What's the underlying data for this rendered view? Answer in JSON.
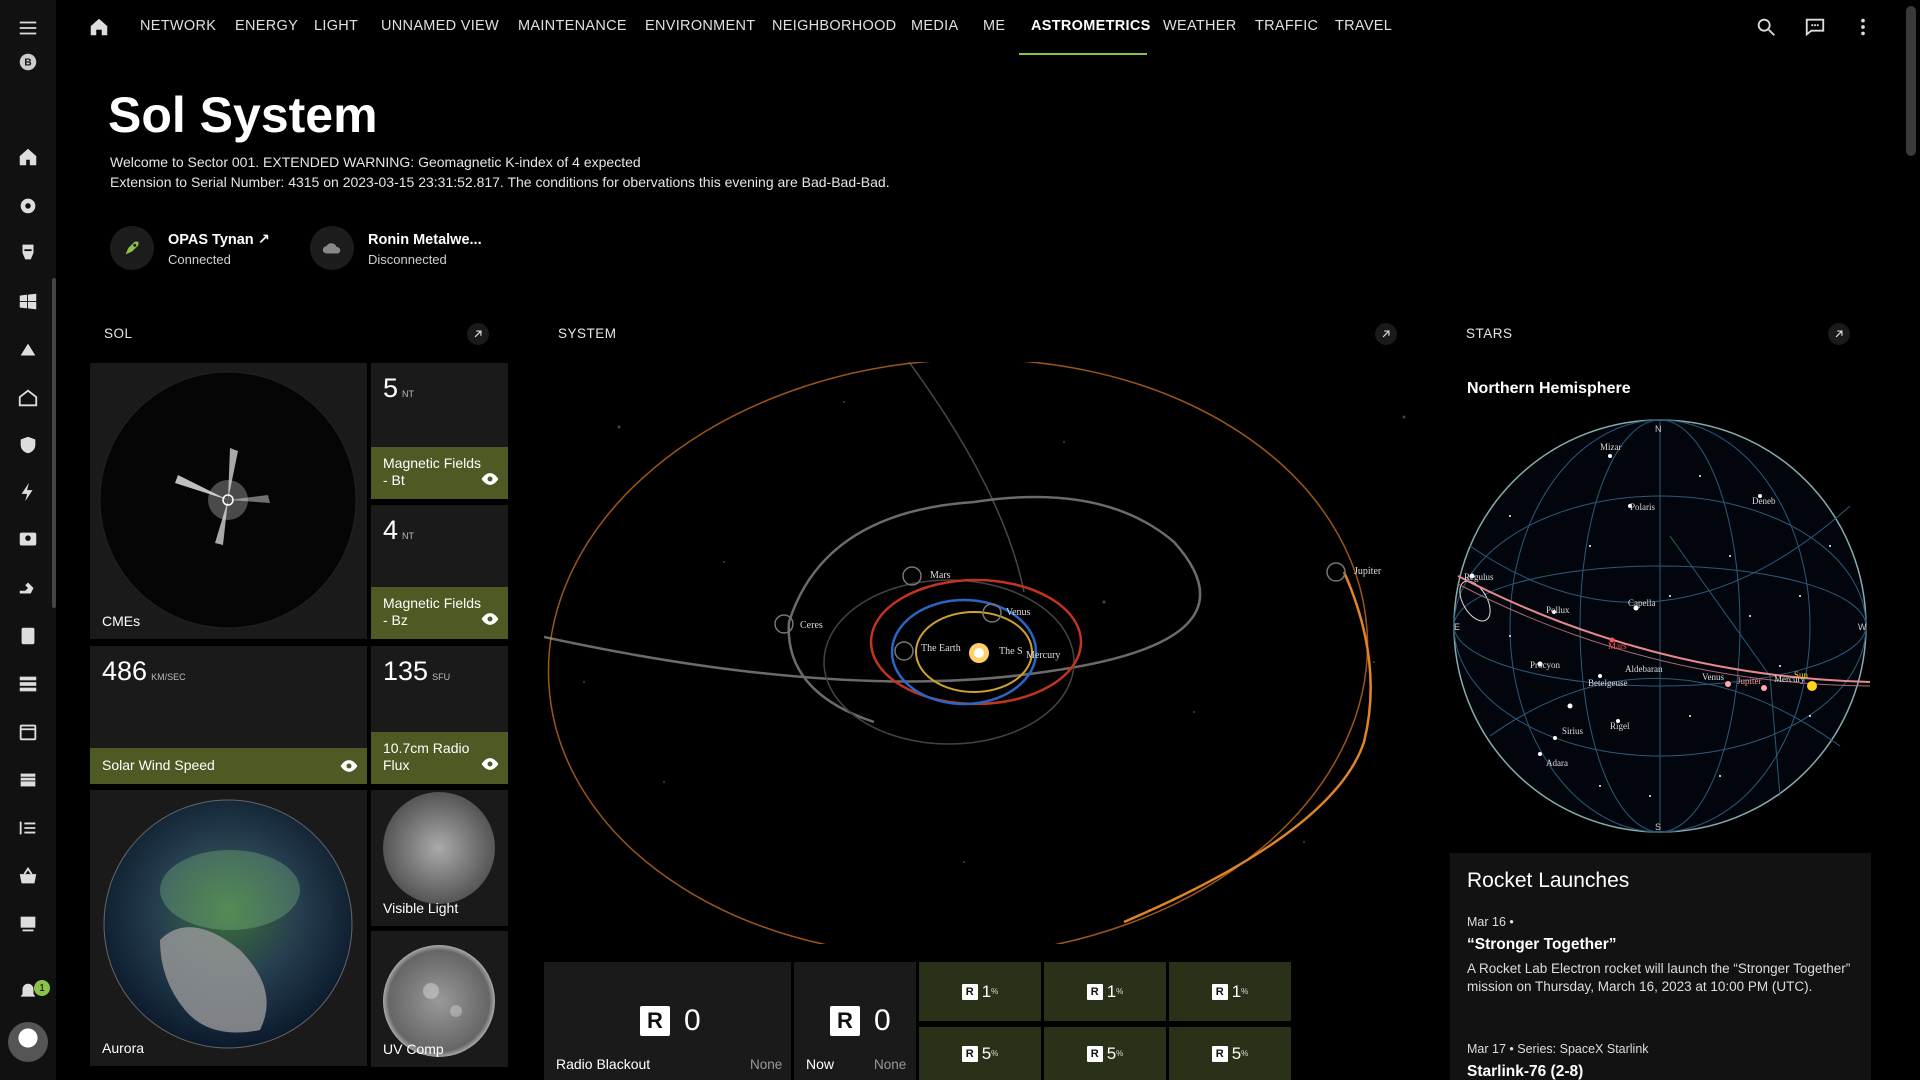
{
  "nav": {
    "tabs": [
      "NETWORK",
      "ENERGY",
      "LIGHT",
      "UNNAMED VIEW",
      "MAINTENANCE",
      "ENVIRONMENT",
      "NEIGHBORHOOD",
      "MEDIA",
      "ME",
      "ASTROMETRICS",
      "WEATHER",
      "TRAFFIC",
      "TRAVEL"
    ],
    "active_tab": "ASTROMETRICS",
    "accent_color": "#8bc34a"
  },
  "sidebar": {
    "icons": [
      "menu-icon",
      "brand-icon",
      "home-icon",
      "rebel-icon",
      "mandalorian-icon",
      "windows-icon",
      "alert-bell-icon",
      "house-icon",
      "shield-icon",
      "lightning-icon",
      "contact-icon",
      "vacuum-icon",
      "device-icon",
      "server-icon",
      "calendar-icon",
      "battery-icon",
      "list-icon",
      "basket-icon",
      "nas-icon",
      "notifications-icon",
      "avatar"
    ],
    "notification_count": "1"
  },
  "header": {
    "title": "Sol System",
    "line1": "Welcome to Sector 001. EXTENDED WARNING: Geomagnetic K-index of 4 expected",
    "line2": "Extension to Serial Number: 4315 on 2023-03-15 23:31:52.817. The conditions for obervations this evening are Bad-Bad-Bad."
  },
  "devices": [
    {
      "name": "OPAS Tynan ↗",
      "status": "Connected"
    },
    {
      "name": "Ronin Metalwe...",
      "status": "Disconnected"
    }
  ],
  "sections": {
    "sol": "SOL",
    "system": "SYSTEM",
    "stars": "STARS"
  },
  "sol": {
    "cmes_label": "CMEs",
    "bt": {
      "value": "5",
      "unit": "NT",
      "label": "Magnetic Fields - Bt"
    },
    "bz": {
      "value": "4",
      "unit": "NT",
      "label": "Magnetic Fields - Bz"
    },
    "wind": {
      "value": "486",
      "unit": "KM/SEC",
      "label": "Solar Wind Speed"
    },
    "flux": {
      "value": "135",
      "unit": "SFU",
      "label": "10.7cm Radio Flux"
    },
    "visible_label": "Visible Light",
    "uv_label": "UV Comp",
    "aurora_label": "Aurora"
  },
  "system": {
    "planets": [
      "Mars",
      "Venus",
      "Ceres",
      "The Earth",
      "The S",
      "Mercury",
      "Jupiter"
    ]
  },
  "stars": {
    "subtitle": "Northern Hemisphere",
    "compass": {
      "n": "N",
      "e": "E",
      "w": "W",
      "s": "S"
    },
    "names": [
      "Mizar",
      "Polaris",
      "Deneb",
      "Regulus",
      "Capella",
      "Pollux",
      "Mars",
      "Procyon",
      "Aldebaran",
      "Venus",
      "Jupiter",
      "Mercury",
      "Sun",
      "Betelgeuse",
      "Sirius",
      "Rigel",
      "Adara"
    ]
  },
  "rocket": {
    "heading": "Rocket Launches",
    "date1": "Mar 16 •",
    "title1": "“Stronger Together”",
    "desc1": "A Rocket Lab Electron rocket will launch the “Stronger Together” mission on Thursday, March 16, 2023 at 10:00 PM (UTC).",
    "date2": "Mar 17 • Series: SpaceX Starlink",
    "title2": "Starlink-76 (2-8)"
  },
  "radio": {
    "badge": "R",
    "blackout": {
      "value": "0",
      "label": "Radio Blackout",
      "none": "None"
    },
    "now": {
      "value": "0",
      "label": "Now",
      "none": "None"
    },
    "grid": [
      {
        "value": "1",
        "pct": "%"
      },
      {
        "value": "1",
        "pct": "%"
      },
      {
        "value": "1",
        "pct": "%"
      },
      {
        "value": "5",
        "pct": "%"
      },
      {
        "value": "5",
        "pct": "%"
      },
      {
        "value": "5",
        "pct": "%"
      }
    ]
  }
}
